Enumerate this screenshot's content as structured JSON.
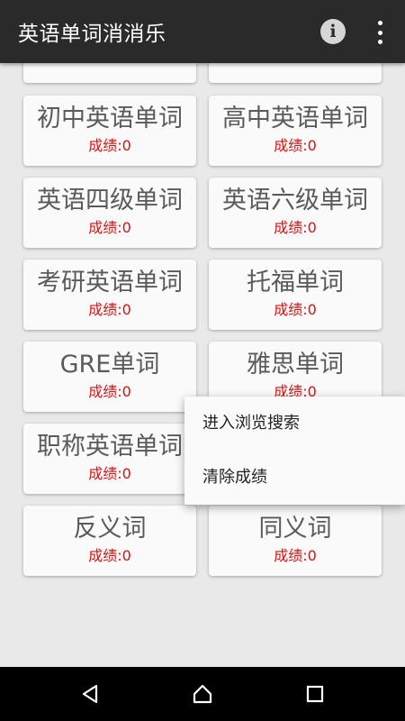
{
  "appbar": {
    "title": "英语单词消消乐",
    "info_icon": "info-icon",
    "more_icon": "more-vert-icon"
  },
  "cards": [
    {
      "title": "",
      "score": ""
    },
    {
      "title": "",
      "score": ""
    },
    {
      "title": "初中英语单词",
      "score": "成绩:0"
    },
    {
      "title": "高中英语单词",
      "score": "成绩:0"
    },
    {
      "title": "英语四级单词",
      "score": "成绩:0"
    },
    {
      "title": "英语六级单词",
      "score": "成绩:0"
    },
    {
      "title": "考研英语单词",
      "score": "成绩:0"
    },
    {
      "title": "托福单词",
      "score": "成绩:0"
    },
    {
      "title": "GRE单词",
      "score": "成绩:0"
    },
    {
      "title": "雅思单词",
      "score": "成绩:0"
    },
    {
      "title": "职称英语单词",
      "score": "成绩:0"
    },
    {
      "title": "",
      "score": ""
    },
    {
      "title": "反义词",
      "score": "成绩:0"
    },
    {
      "title": "同义词",
      "score": "成绩:0"
    }
  ],
  "menu": {
    "items": [
      {
        "label": "进入浏览搜索"
      },
      {
        "label": "清除成绩"
      }
    ]
  },
  "navbar": {
    "back_icon": "back-triangle-icon",
    "home_icon": "home-icon",
    "recents_icon": "recents-square-icon"
  },
  "colors": {
    "appbar_bg": "#2a2a2a",
    "score_red": "#e01010",
    "background": "#e9e9e9"
  }
}
